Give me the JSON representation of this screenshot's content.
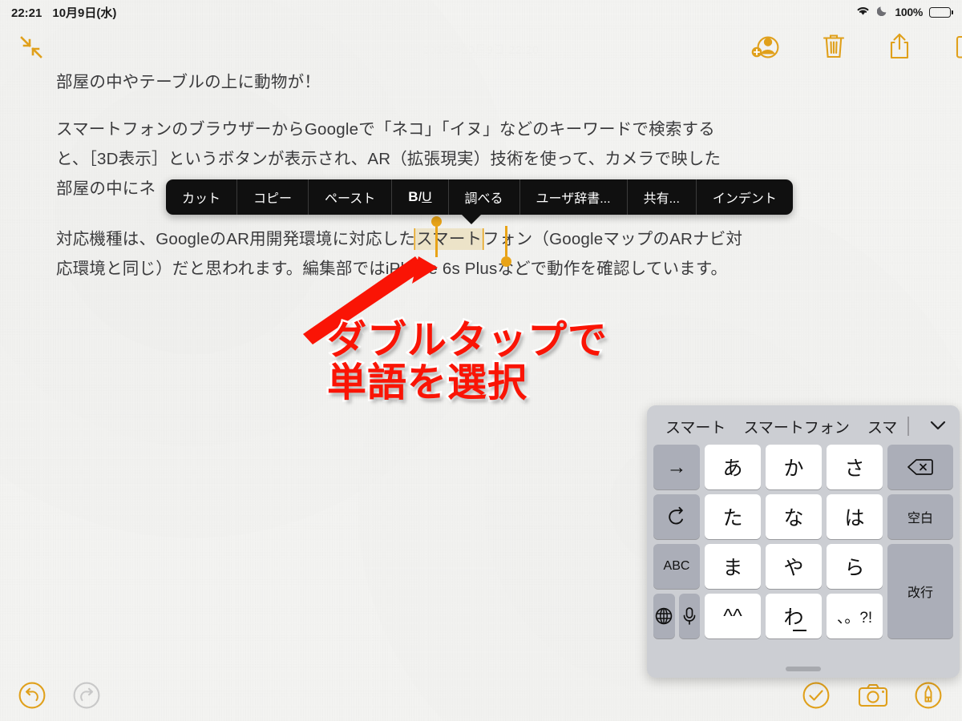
{
  "status_bar": {
    "time": "22:21",
    "date": "10月9日(水)",
    "wifi_icon": "wifi-icon",
    "dnd_icon": "moon-do-not-disturb-icon",
    "battery_percent": "100%"
  },
  "toolbar_top": {
    "collapse_icon": "collapse-arrows-icon",
    "add_person_icon": "add-person-icon",
    "trash_icon": "trash-icon",
    "share_icon": "share-icon",
    "compose_icon": "compose-icon"
  },
  "note": {
    "date_header": "2019年10月9日 22:20",
    "paragraph1": "部屋の中やテーブルの上に動物が！",
    "paragraph2_line1": "スマートフォンのブラウザーからGoogleで「ネコ」「イヌ」などのキーワードで検索する",
    "paragraph2_line2": "と、［3D表示］というボタンが表示され、AR（拡張現実）技術を使って、カメラで映した",
    "paragraph2_line3": "部屋の中にネ",
    "paragraph3_before": "対応機種は、GoogleのAR用開発環境に対応した",
    "paragraph3_selected": "スマート",
    "paragraph3_after": "フォン（GoogleマップのARナビ対",
    "paragraph3_line2": "応環境と同じ）だと思われます。編集部ではiPhone 6s Plusなどで動作を確認しています。"
  },
  "context_menu": {
    "items": [
      {
        "label": "カット",
        "name": "menu-item-cut"
      },
      {
        "label": "コピー",
        "name": "menu-item-copy"
      },
      {
        "label": "ペースト",
        "name": "menu-item-paste"
      },
      {
        "label": "BIU",
        "name": "menu-item-style"
      },
      {
        "label": "調べる",
        "name": "menu-item-lookup"
      },
      {
        "label": "ユーザ辞書...",
        "name": "menu-item-user-dictionary"
      },
      {
        "label": "共有...",
        "name": "menu-item-share"
      },
      {
        "label": "インデント",
        "name": "menu-item-indent"
      }
    ],
    "style_bold": "B",
    "style_italic": "I",
    "style_underline": "U"
  },
  "annotation": {
    "line1": "ダブルタップで",
    "line2": "単語を選択",
    "color": "#FA1405",
    "arrow_icon": "red-arrow-icon"
  },
  "keyboard": {
    "predictions": [
      "スマート",
      "スマートフォン",
      "スマ"
    ],
    "collapse_icon": "chevron-down-icon",
    "keys": [
      {
        "label": "→",
        "name": "key-next-candidate",
        "style": "fn"
      },
      {
        "label": "あ",
        "name": "key-a",
        "style": "char"
      },
      {
        "label": "か",
        "name": "key-ka",
        "style": "char"
      },
      {
        "label": "さ",
        "name": "key-sa",
        "style": "char"
      },
      {
        "label": "⌫",
        "name": "key-backspace",
        "style": "fn"
      },
      {
        "label": "↺",
        "name": "key-undo",
        "style": "fn"
      },
      {
        "label": "た",
        "name": "key-ta",
        "style": "char"
      },
      {
        "label": "な",
        "name": "key-na",
        "style": "char"
      },
      {
        "label": "は",
        "name": "key-ha",
        "style": "char"
      },
      {
        "label": "空白",
        "name": "key-space",
        "style": "fn-small"
      },
      {
        "label": "ABC",
        "name": "key-abc",
        "style": "fn-small"
      },
      {
        "label": "ま",
        "name": "key-ma",
        "style": "char"
      },
      {
        "label": "や",
        "name": "key-ya",
        "style": "char"
      },
      {
        "label": "ら",
        "name": "key-ra",
        "style": "char"
      },
      {
        "label": "改行",
        "name": "key-return",
        "style": "fn-small-tall"
      },
      {
        "label": "🌐",
        "name": "key-globe",
        "style": "fn"
      },
      {
        "label": "🎤",
        "name": "key-microphone",
        "style": "fn"
      },
      {
        "label": "^^",
        "name": "key-emoticon",
        "style": "char"
      },
      {
        "label": "わ",
        "name": "key-wa",
        "style": "char"
      },
      {
        "label": "、。?!",
        "name": "key-punctuation",
        "style": "char-small"
      }
    ],
    "key_globe": "🌐",
    "key_mic": "🎤",
    "handle": "keyboard-drag-handle"
  },
  "toolbar_bottom": {
    "undo_icon": "undo-icon",
    "redo_icon": "redo-icon",
    "done_icon": "checkmark-circle-icon",
    "camera_icon": "camera-icon",
    "markup_icon": "markup-pen-icon"
  },
  "colors": {
    "accent": "#E0A01B",
    "accent_disabled": "#C8C8C8",
    "selection_fill": "#ECE3C8",
    "selection_handle": "#E8A317",
    "annotation_red": "#FA1405",
    "menu_bg": "#101010",
    "keyboard_bg": "#CCCED3"
  }
}
